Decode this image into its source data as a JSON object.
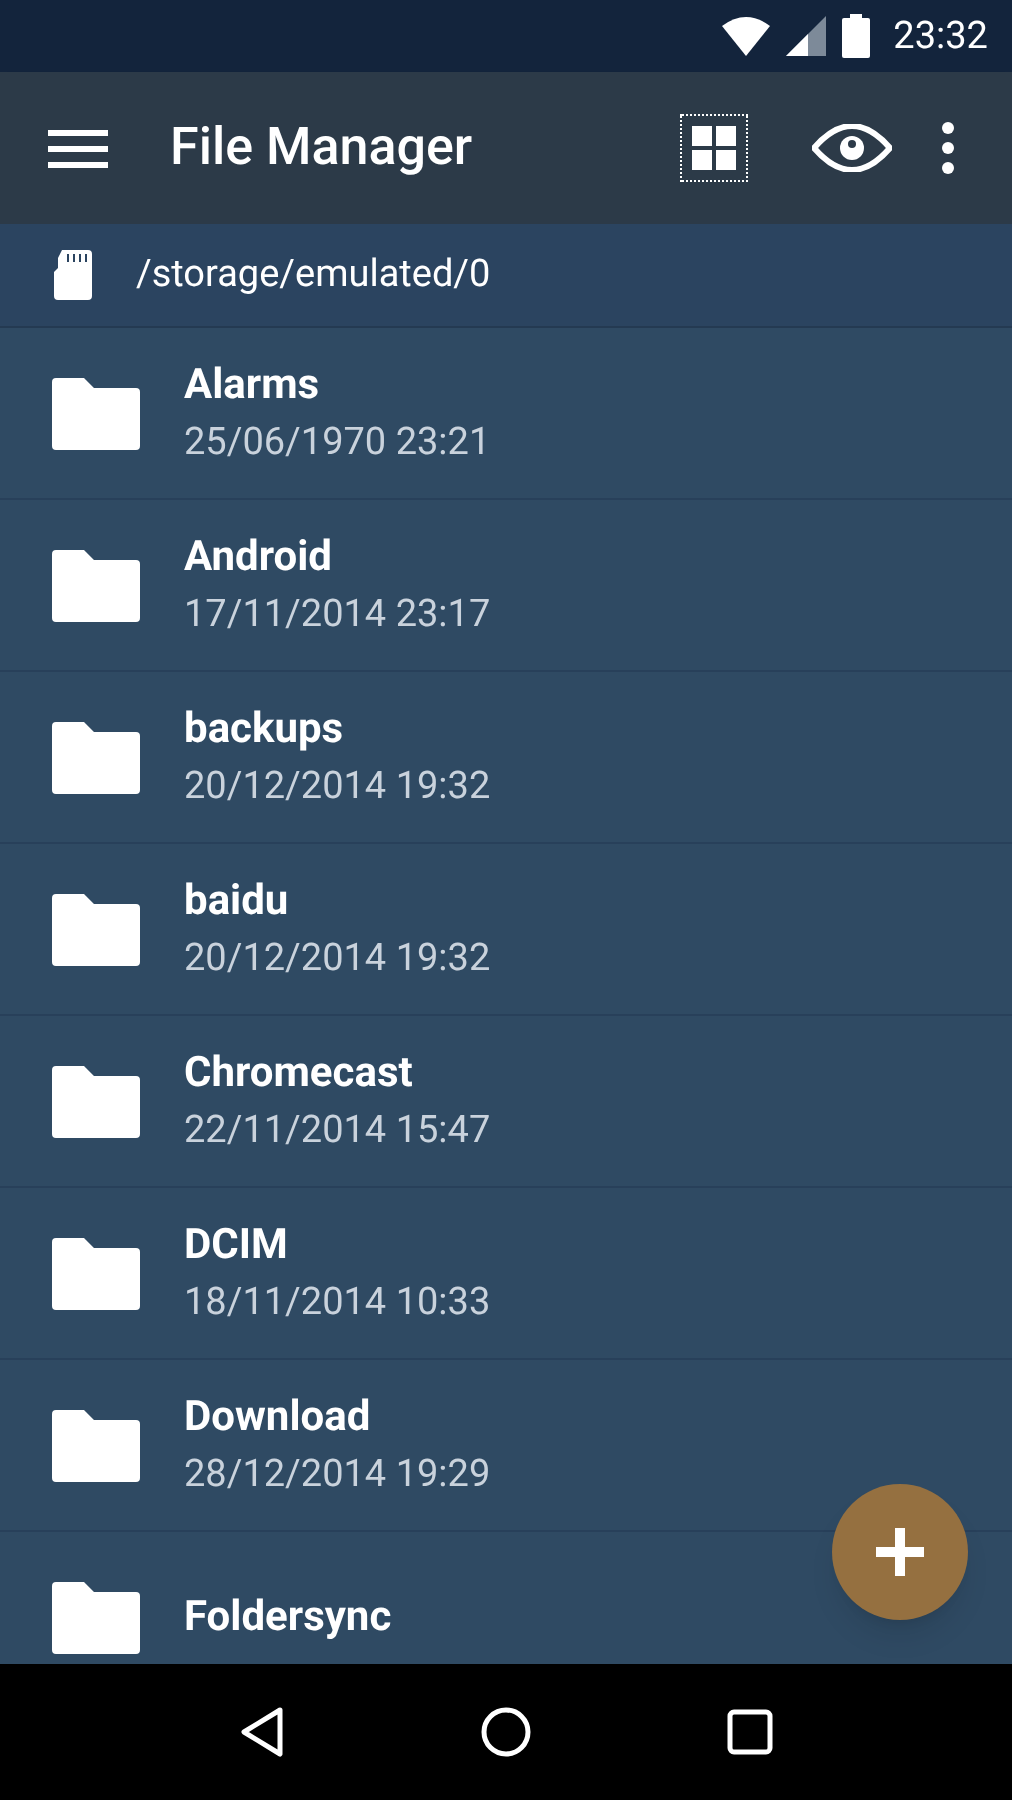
{
  "status_bar": {
    "time": "23:32"
  },
  "toolbar": {
    "title": "File Manager"
  },
  "path_bar": {
    "path": "/storage/emulated/0"
  },
  "folders": [
    {
      "name": "Alarms",
      "date": "25/06/1970 23:21"
    },
    {
      "name": "Android",
      "date": "17/11/2014 23:17"
    },
    {
      "name": "backups",
      "date": "20/12/2014 19:32"
    },
    {
      "name": "baidu",
      "date": "20/12/2014 19:32"
    },
    {
      "name": "Chromecast",
      "date": "22/11/2014 15:47"
    },
    {
      "name": "DCIM",
      "date": "18/11/2014 10:33"
    },
    {
      "name": "Download",
      "date": "28/12/2014 19:29"
    },
    {
      "name": "Foldersync"
    }
  ]
}
